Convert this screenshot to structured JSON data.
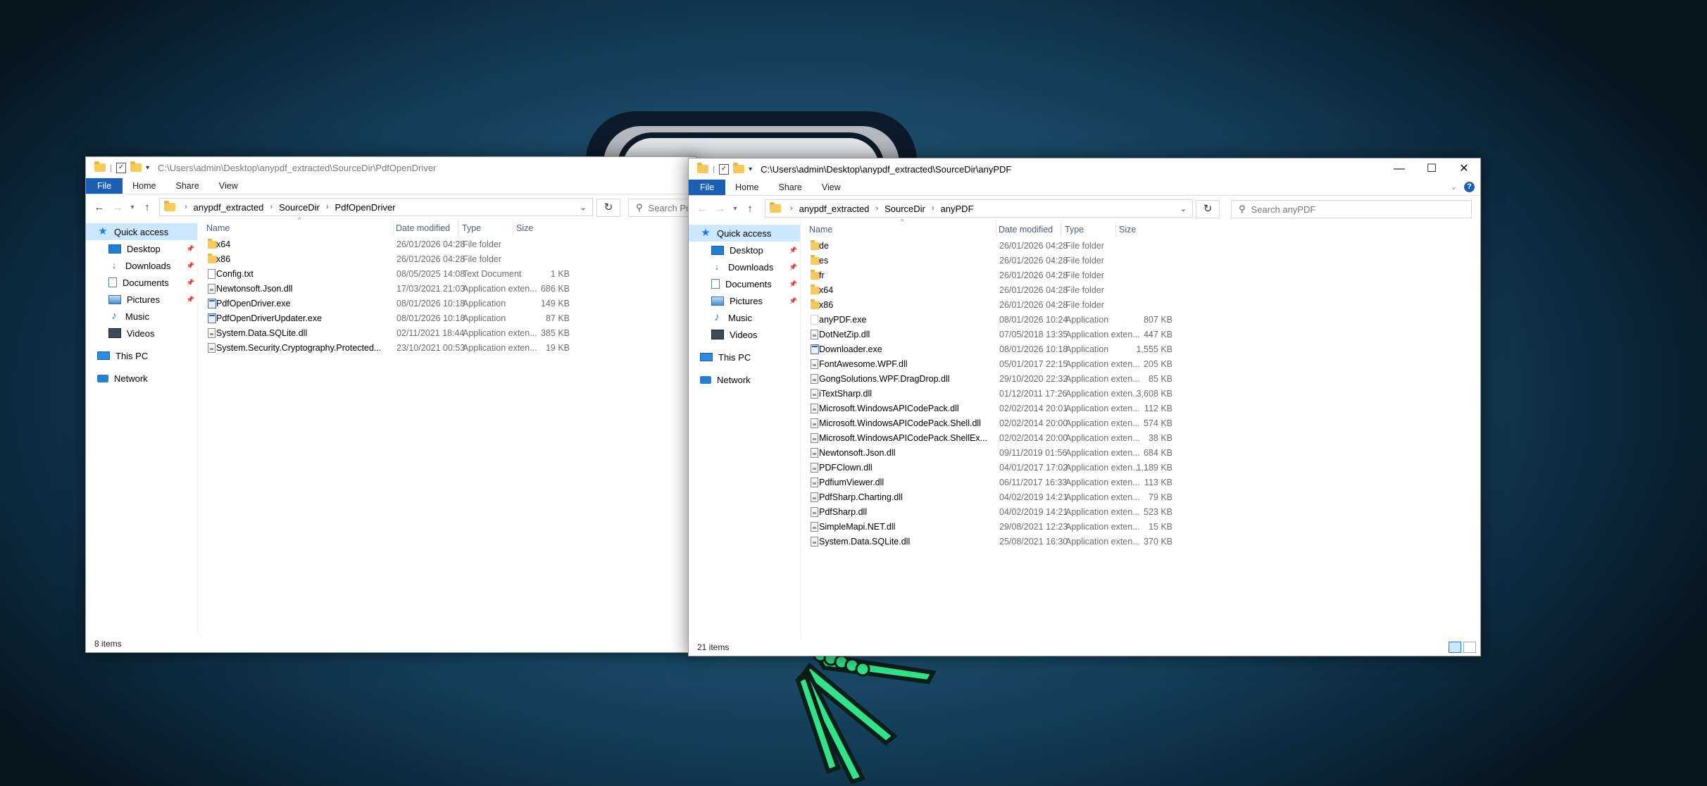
{
  "windows": {
    "left": {
      "title_path": "C:\\Users\\admin\\Desktop\\anypdf_extracted\\SourceDir\\PdfOpenDriver",
      "ribbon_tabs": [
        "File",
        "Home",
        "Share",
        "View"
      ],
      "address": [
        "anypdf_extracted",
        "SourceDir",
        "PdfOpenDriver"
      ],
      "search_placeholder": "Search PdfOpenDriver",
      "columns": {
        "name": "Name",
        "date": "Date modified",
        "type": "Type",
        "size": "Size"
      },
      "nav": [
        {
          "label": "Quick access",
          "icon": "star-icon",
          "pinned": false
        },
        {
          "label": "Desktop",
          "icon": "desktop-icon",
          "pinned": true
        },
        {
          "label": "Downloads",
          "icon": "downloads-icon",
          "pinned": true
        },
        {
          "label": "Documents",
          "icon": "documents-icon",
          "pinned": true
        },
        {
          "label": "Pictures",
          "icon": "pictures-icon",
          "pinned": true
        },
        {
          "label": "Music",
          "icon": "music-icon",
          "pinned": false
        },
        {
          "label": "Videos",
          "icon": "videos-icon",
          "pinned": false
        },
        {
          "label": "This PC",
          "icon": "this-pc-icon",
          "pinned": false
        },
        {
          "label": "Network",
          "icon": "network-icon",
          "pinned": false
        }
      ],
      "files": [
        {
          "name": "x64",
          "date": "26/01/2026 04:28",
          "type": "File folder",
          "size": "",
          "icon": "folder-icon"
        },
        {
          "name": "x86",
          "date": "26/01/2026 04:28",
          "type": "File folder",
          "size": "",
          "icon": "folder-icon"
        },
        {
          "name": "Config.txt",
          "date": "08/05/2025 14:08",
          "type": "Text Document",
          "size": "1 KB",
          "icon": "text-file-icon"
        },
        {
          "name": "Newtonsoft.Json.dll",
          "date": "17/03/2021 21:03",
          "type": "Application exten...",
          "size": "686 KB",
          "icon": "dll-icon"
        },
        {
          "name": "PdfOpenDriver.exe",
          "date": "08/01/2026 10:18",
          "type": "Application",
          "size": "149 KB",
          "icon": "exe-icon"
        },
        {
          "name": "PdfOpenDriverUpdater.exe",
          "date": "08/01/2026 10:18",
          "type": "Application",
          "size": "87 KB",
          "icon": "exe-icon"
        },
        {
          "name": "System.Data.SQLite.dll",
          "date": "02/11/2021 18:44",
          "type": "Application exten...",
          "size": "385 KB",
          "icon": "dll-icon"
        },
        {
          "name": "System.Security.Cryptography.Protected...",
          "date": "23/10/2021 00:53",
          "type": "Application exten...",
          "size": "19 KB",
          "icon": "dll-icon"
        }
      ],
      "status": "8 items"
    },
    "right": {
      "title_path": "C:\\Users\\admin\\Desktop\\anypdf_extracted\\SourceDir\\anyPDF",
      "ribbon_tabs": [
        "File",
        "Home",
        "Share",
        "View"
      ],
      "address": [
        "anypdf_extracted",
        "SourceDir",
        "anyPDF"
      ],
      "search_placeholder": "Search anyPDF",
      "columns": {
        "name": "Name",
        "date": "Date modified",
        "type": "Type",
        "size": "Size"
      },
      "nav": [
        {
          "label": "Quick access",
          "icon": "star-icon",
          "pinned": false
        },
        {
          "label": "Desktop",
          "icon": "desktop-icon",
          "pinned": true
        },
        {
          "label": "Downloads",
          "icon": "downloads-icon",
          "pinned": true
        },
        {
          "label": "Documents",
          "icon": "documents-icon",
          "pinned": true
        },
        {
          "label": "Pictures",
          "icon": "pictures-icon",
          "pinned": true
        },
        {
          "label": "Music",
          "icon": "music-icon",
          "pinned": false
        },
        {
          "label": "Videos",
          "icon": "videos-icon",
          "pinned": false
        },
        {
          "label": "This PC",
          "icon": "this-pc-icon",
          "pinned": false
        },
        {
          "label": "Network",
          "icon": "network-icon",
          "pinned": false
        }
      ],
      "files": [
        {
          "name": "de",
          "date": "26/01/2026 04:28",
          "type": "File folder",
          "size": "",
          "icon": "folder-icon"
        },
        {
          "name": "es",
          "date": "26/01/2026 04:28",
          "type": "File folder",
          "size": "",
          "icon": "folder-icon"
        },
        {
          "name": "fr",
          "date": "26/01/2026 04:28",
          "type": "File folder",
          "size": "",
          "icon": "folder-icon"
        },
        {
          "name": "x64",
          "date": "26/01/2026 04:28",
          "type": "File folder",
          "size": "",
          "icon": "folder-icon"
        },
        {
          "name": "x86",
          "date": "26/01/2026 04:28",
          "type": "File folder",
          "size": "",
          "icon": "folder-icon"
        },
        {
          "name": "anyPDF.exe",
          "date": "08/01/2026 10:24",
          "type": "Application",
          "size": "807 KB",
          "icon": "blank-exe-icon"
        },
        {
          "name": "DotNetZip.dll",
          "date": "07/05/2018 13:35",
          "type": "Application exten...",
          "size": "447 KB",
          "icon": "dll-icon"
        },
        {
          "name": "Downloader.exe",
          "date": "08/01/2026 10:18",
          "type": "Application",
          "size": "1,555 KB",
          "icon": "exe-icon"
        },
        {
          "name": "FontAwesome.WPF.dll",
          "date": "05/01/2017 22:15",
          "type": "Application exten...",
          "size": "205 KB",
          "icon": "dll-icon"
        },
        {
          "name": "GongSolutions.WPF.DragDrop.dll",
          "date": "29/10/2020 22:32",
          "type": "Application exten...",
          "size": "85 KB",
          "icon": "dll-icon"
        },
        {
          "name": "iTextSharp.dll",
          "date": "01/12/2011 17:26",
          "type": "Application exten...",
          "size": "3,608 KB",
          "icon": "dll-icon"
        },
        {
          "name": "Microsoft.WindowsAPICodePack.dll",
          "date": "02/02/2014 20:01",
          "type": "Application exten...",
          "size": "112 KB",
          "icon": "dll-icon"
        },
        {
          "name": "Microsoft.WindowsAPICodePack.Shell.dll",
          "date": "02/02/2014 20:00",
          "type": "Application exten...",
          "size": "574 KB",
          "icon": "dll-icon"
        },
        {
          "name": "Microsoft.WindowsAPICodePack.ShellEx...",
          "date": "02/02/2014 20:00",
          "type": "Application exten...",
          "size": "38 KB",
          "icon": "dll-icon"
        },
        {
          "name": "Newtonsoft.Json.dll",
          "date": "09/11/2019 01:56",
          "type": "Application exten...",
          "size": "684 KB",
          "icon": "dll-icon"
        },
        {
          "name": "PDFClown.dll",
          "date": "04/01/2017 17:02",
          "type": "Application exten...",
          "size": "1,189 KB",
          "icon": "dll-icon"
        },
        {
          "name": "PdfiumViewer.dll",
          "date": "06/11/2017 16:33",
          "type": "Application exten...",
          "size": "113 KB",
          "icon": "dll-icon"
        },
        {
          "name": "PdfSharp.Charting.dll",
          "date": "04/02/2019 14:21",
          "type": "Application exten...",
          "size": "79 KB",
          "icon": "dll-icon"
        },
        {
          "name": "PdfSharp.dll",
          "date": "04/02/2019 14:21",
          "type": "Application exten...",
          "size": "523 KB",
          "icon": "dll-icon"
        },
        {
          "name": "SimpleMapi.NET.dll",
          "date": "29/08/2021 12:23",
          "type": "Application exten...",
          "size": "15 KB",
          "icon": "dll-icon"
        },
        {
          "name": "System.Data.SQLite.dll",
          "date": "25/08/2021 16:30",
          "type": "Application exten...",
          "size": "370 KB",
          "icon": "dll-icon"
        }
      ],
      "status": "21 items"
    }
  },
  "colors": {
    "accent": "#1a5fb4",
    "selection": "#cce8ff",
    "folder": "#f6c95c"
  }
}
